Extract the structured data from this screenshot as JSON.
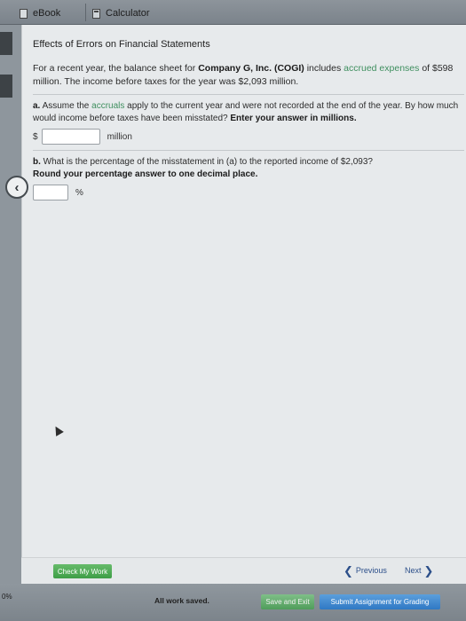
{
  "tabs": {
    "ebook": "eBook",
    "calculator": "Calculator"
  },
  "problem": {
    "heading": "Effects of Errors on Financial Statements",
    "intro_1": "For a recent year, the balance sheet for ",
    "company": "Company G, Inc. (COGI)",
    "intro_2": " includes ",
    "accrued": "accrued expenses",
    "intro_3": "of $598 million. The income before taxes for the year was $2,093 million."
  },
  "part_a": {
    "label": "a.",
    "text_1": " Assume the ",
    "accruals": "accruals",
    "text_2": " apply to the current year and were not recorded at the end of the year. By how much would income before taxes have been misstated? ",
    "bold": "Enter your answer in millions.",
    "currency": "$",
    "answer_value": "",
    "unit": "million"
  },
  "part_b": {
    "label": "b.",
    "text": " What is the percentage of the misstatement in (a) to the reported income of $2,093?",
    "bold": "Round your percentage answer to one decimal place.",
    "answer_value": "",
    "unit": "%"
  },
  "nav": {
    "check_label": "Check My Work",
    "previous": "Previous",
    "next": "Next"
  },
  "status": {
    "progress": "0%",
    "saved": "All work saved.",
    "save_exit": "Save and Exit",
    "submit": "Submit Assignment for Grading"
  },
  "colors": {
    "accent_green": "#3f8f5f",
    "check_button": "#4caf50",
    "submit_button": "#2f78c4"
  }
}
